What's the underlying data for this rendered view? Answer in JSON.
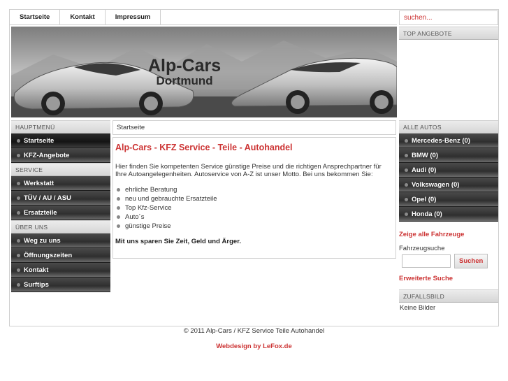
{
  "nav": {
    "items": [
      "Startseite",
      "Kontakt",
      "Impressum"
    ],
    "search_placeholder": "suchen..."
  },
  "header": {
    "logo_line1": "Alp-Cars",
    "logo_line2": "Dortmund"
  },
  "left_menu": {
    "sections": [
      {
        "heading": "HAUPTMENÜ",
        "items": [
          "Startseite",
          "KFZ-Angebote"
        ]
      },
      {
        "heading": "SERVICE",
        "items": [
          "Werkstatt",
          "TÜV / AU / ASU",
          "Ersatzteile"
        ]
      },
      {
        "heading": "ÜBER UNS",
        "items": [
          "Weg zu uns",
          "Öffnungszeiten",
          "Kontakt",
          "Surftips"
        ]
      }
    ]
  },
  "breadcrumb": "Startseite",
  "content": {
    "title": "Alp-Cars - KFZ Service - Teile - Autohandel",
    "intro": "Hier finden Sie kompetenten Service günstige Preise und die richtigen Ansprechpartner für Ihre Autoangelegenheiten. Autoservice von A-Z ist unser Motto. Bei uns bekommen Sie:",
    "list": [
      "ehrliche Beratung",
      "neu und gebrauchte Ersatzteile",
      "Top Kfz-Service",
      "Auto´s",
      "günstige Preise"
    ],
    "closing": "Mit uns sparen Sie Zeit, Geld und Ärger."
  },
  "right": {
    "top_offers_heading": "TOP ANGEBOTE",
    "all_autos_heading": "ALLE AUTOS",
    "autos": [
      "Mercedes-Benz (0)",
      "BMW (0)",
      "Audi (0)",
      "Volkswagen (0)",
      "Opel (0)",
      "Honda (0)"
    ],
    "show_all": "Zeige alle Fahrzeuge",
    "search_label": "Fahrzeugsuche",
    "search_button": "Suchen",
    "advanced_search": "Erweiterte Suche",
    "random_heading": "ZUFALLSBILD",
    "no_images": "Keine Bilder"
  },
  "footer": {
    "copyright": "© 2011 Alp-Cars / KFZ Service Teile Autohandel",
    "credit": "Webdesign by LeFox.de"
  },
  "colors": {
    "accent": "#cc3333",
    "menu_dark": "#2f2f2f",
    "border": "#cfcfcf"
  }
}
